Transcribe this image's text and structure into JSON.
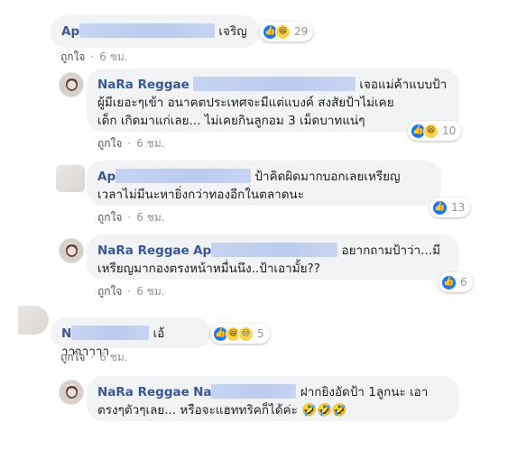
{
  "like_label": "ถูกใจ",
  "time": "6 ชม.",
  "reaction_icons": {
    "like": "like-icon",
    "haha": "haha-icon",
    "sad": "sad-icon"
  },
  "colors": {
    "name": "#385898",
    "bubble": "#f2f3f5",
    "like": "#1877f2",
    "meta": "#90949c"
  },
  "comments": [
    {
      "name": "Ap",
      "text": "เจริญ",
      "reactions": "29"
    },
    {
      "name": "NaRa Reggae",
      "line1": "เจอแม่ค้าแบบป้า",
      "line2": "ผู้มีเยอะๆเข้า อนาคตประเทศจะมีแต่แบงค์ สงสัยป้าไม่เคย",
      "line3": "เด็ก เกิดมาแก่เลย... ไม่เคยกินลูกอม 3 เม็ดบาทแน่ๆ",
      "reactions": "10"
    },
    {
      "name": "Ap",
      "line1": "ป้าคิดผิดมากบอกเลยเหรียญ",
      "line2": "เวลาไม่มีนะหายิ่งกว่าทองอีกในตลาดนะ",
      "reactions": "13"
    },
    {
      "name": "NaRa Reggae",
      "mention": "Ap",
      "line1": "อยากถามป้าว่า...มี",
      "line2": "เหรียญมากองตรงหน้าหมื่นนึง..ป้าเอามั้ย??",
      "reactions": "6"
    },
    {
      "name": "N",
      "text": "เอ้าาาาาาา",
      "reactions": "5"
    },
    {
      "name": "NaRa Reggae",
      "mention": "Na",
      "line1": "ฝากยิงอัดป้า 1ลูกนะ เอา",
      "line2": "ตรงๆตัวๆเลย... หรือจะแฮททริคก็ได้ค่ะ 🤣🤣🤣"
    }
  ]
}
